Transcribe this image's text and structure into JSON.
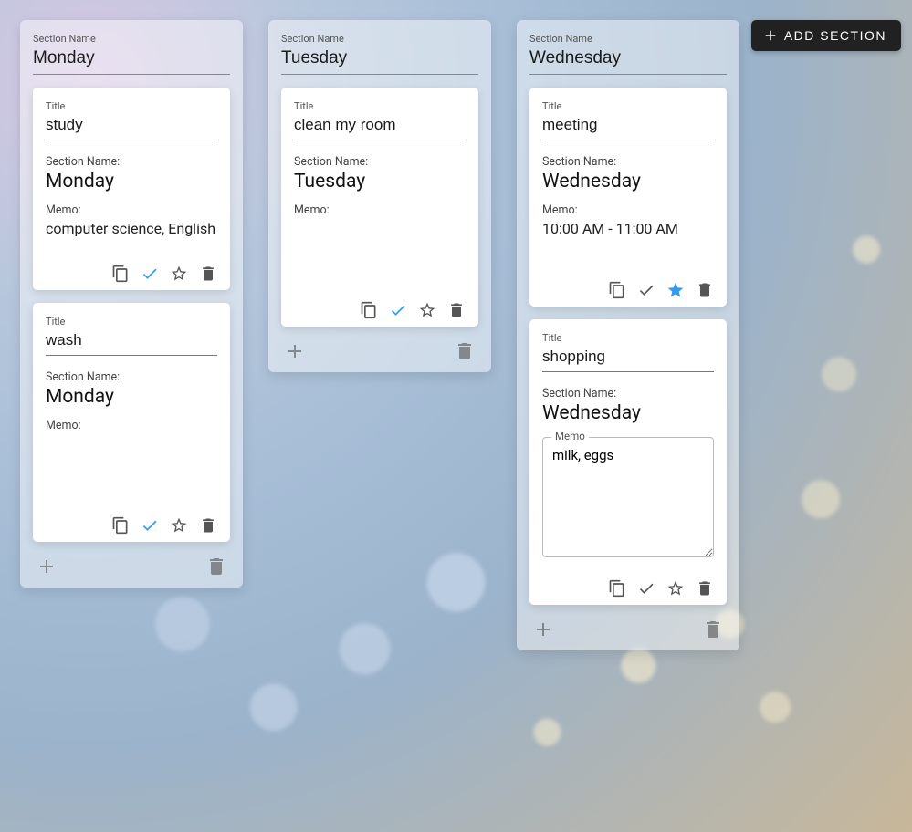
{
  "header": {
    "add_section_label": "ADD SECTION"
  },
  "labels": {
    "section_name": "Section Name",
    "title": "Title",
    "section_name_colon": "Section Name:",
    "memo_colon": "Memo:",
    "memo": "Memo"
  },
  "icons": {
    "copy": "copy-icon",
    "check": "check-icon",
    "star": "star-icon",
    "trash": "trash-icon",
    "add": "add-icon"
  },
  "sections": [
    {
      "name": "Monday",
      "tasks": [
        {
          "title": "study",
          "section_name": "Monday",
          "memo": "computer science, English",
          "check_active": true,
          "star_active": false,
          "memo_editing": false
        },
        {
          "title": "wash",
          "section_name": "Monday",
          "memo": "",
          "check_active": true,
          "star_active": false,
          "memo_editing": false
        }
      ]
    },
    {
      "name": "Tuesday",
      "tasks": [
        {
          "title": "clean my room",
          "section_name": "Tuesday",
          "memo": "",
          "check_active": true,
          "star_active": false,
          "memo_editing": false
        }
      ]
    },
    {
      "name": "Wednesday",
      "tasks": [
        {
          "title": "meeting",
          "section_name": "Wednesday",
          "memo": "10:00 AM - 11:00 AM",
          "check_active": false,
          "star_active": true,
          "memo_editing": false
        },
        {
          "title": "shopping",
          "section_name": "Wednesday",
          "memo": "milk, eggs",
          "check_active": false,
          "star_active": false,
          "memo_editing": true
        }
      ]
    }
  ]
}
